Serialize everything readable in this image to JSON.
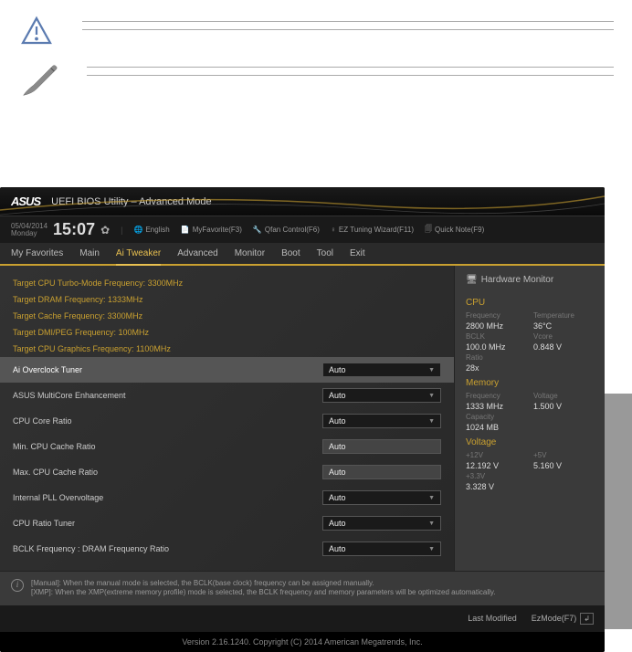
{
  "header": {
    "brand": "ASUS",
    "title": "UEFI BIOS Utility – Advanced Mode"
  },
  "datetime": {
    "date": "05/04/2014",
    "day": "Monday",
    "time": "15:07"
  },
  "toolbar": {
    "language": "English",
    "favorites": "MyFavorite(F3)",
    "qfan": "Qfan Control(F6)",
    "tuning": "EZ Tuning Wizard(F11)",
    "notes": "Quick Note(F9)"
  },
  "tabs": {
    "favorites": "My Favorites",
    "main": "Main",
    "aitweaker": "Ai Tweaker",
    "advanced": "Advanced",
    "monitor": "Monitor",
    "boot": "Boot",
    "tool": "Tool",
    "exit": "Exit"
  },
  "targets": [
    "Target CPU Turbo-Mode Frequency: 3300MHz",
    "Target DRAM Frequency: 1333MHz",
    "Target Cache Frequency: 3300MHz",
    "Target DMI/PEG Frequency: 100MHz",
    "Target CPU Graphics Frequency: 1100MHz"
  ],
  "settings": [
    {
      "label": "Ai Overclock Tuner",
      "value": "Auto",
      "selected": true,
      "locked": false
    },
    {
      "label": "ASUS MultiCore Enhancement",
      "value": "Auto",
      "selected": false,
      "locked": false
    },
    {
      "label": "CPU Core Ratio",
      "value": "Auto",
      "selected": false,
      "locked": false
    },
    {
      "label": "Min. CPU Cache Ratio",
      "value": "Auto",
      "selected": false,
      "locked": true
    },
    {
      "label": "Max. CPU Cache Ratio",
      "value": "Auto",
      "selected": false,
      "locked": true
    },
    {
      "label": "Internal PLL Overvoltage",
      "value": "Auto",
      "selected": false,
      "locked": false
    },
    {
      "label": "CPU Ratio Tuner",
      "value": "Auto",
      "selected": false,
      "locked": false
    },
    {
      "label": "BCLK Frequency : DRAM Frequency Ratio",
      "value": "Auto",
      "selected": false,
      "locked": false
    }
  ],
  "hwmonitor": {
    "title": "Hardware Monitor",
    "cpu": {
      "title": "CPU",
      "freq_label": "Frequency",
      "freq": "2800 MHz",
      "temp_label": "Temperature",
      "temp": "36°C",
      "bclk_label": "BCLK",
      "bclk": "100.0 MHz",
      "vcore_label": "Vcore",
      "vcore": "0.848 V",
      "ratio_label": "Ratio",
      "ratio": "28x"
    },
    "memory": {
      "title": "Memory",
      "freq_label": "Frequency",
      "freq": "1333 MHz",
      "volt_label": "Voltage",
      "volt": "1.500 V",
      "cap_label": "Capacity",
      "cap": "1024 MB"
    },
    "voltage": {
      "title": "Voltage",
      "v12_label": "+12V",
      "v12": "12.192 V",
      "v5_label": "+5V",
      "v5": "5.160 V",
      "v33_label": "+3.3V",
      "v33": "3.328 V"
    }
  },
  "help": {
    "text": "[Manual]: When the manual mode is selected, the BCLK(base clock) frequency can be assigned manually.\n[XMP]: When the XMP(extreme memory profile) mode is selected, the BCLK frequency and memory parameters will be optimized automatically."
  },
  "footer": {
    "last_modified": "Last Modified",
    "ezmode": "EzMode(F7)"
  },
  "copyright": "Version 2.16.1240. Copyright (C) 2014 American Megatrends, Inc."
}
